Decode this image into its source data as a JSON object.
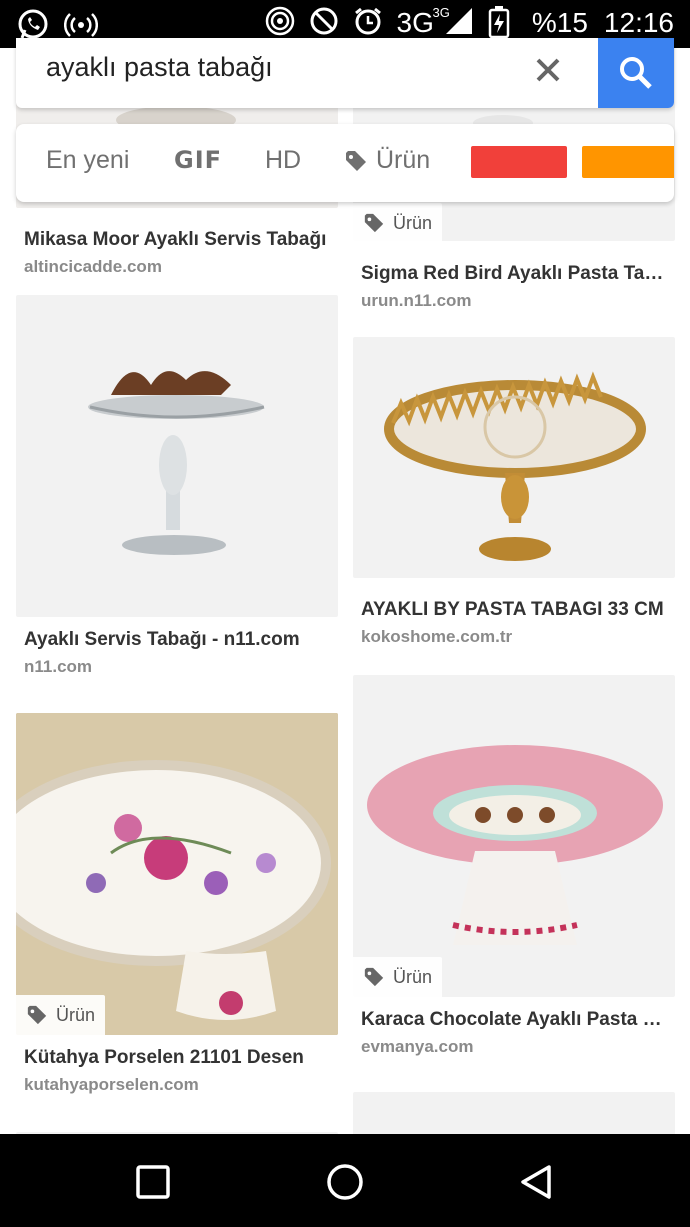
{
  "status_bar": {
    "icons": [
      "whatsapp-icon",
      "broadcast-icon",
      "hotspot-icon",
      "do-not-disturb-icon",
      "alarm-icon",
      "signal-icon",
      "battery-icon"
    ],
    "network": "3G",
    "network_sup": "3G",
    "battery": "%15",
    "time": "12:16"
  },
  "search": {
    "query": "ayaklı pasta tabağı",
    "clear_icon": "close-icon",
    "search_icon": "search-icon"
  },
  "filters": {
    "chips": [
      "En yeni",
      "GIF",
      "HD",
      "Ürün"
    ],
    "color_swatches": [
      "#f1403a",
      "#ff9500"
    ]
  },
  "results": [
    {
      "title": "Mikasa Moor Ayaklı Servis Tabağı",
      "domain": "altincicadde.com",
      "badge": ""
    },
    {
      "title": "Sigma Red Bird Ayaklı Pasta Tabağı",
      "domain": "urun.n11.com",
      "badge": "Ürün"
    },
    {
      "title": "Ayaklı Servis Tabağı - n11.com",
      "domain": "n11.com",
      "badge": ""
    },
    {
      "title": "AYAKLI BY PASTA TABAGI 33 CM",
      "domain": "kokoshome.com.tr",
      "badge": ""
    },
    {
      "title": "Kütahya Porselen 21101 Desen",
      "domain": "kutahyaporselen.com",
      "badge": "Ürün"
    },
    {
      "title": "Karaca Chocolate Ayaklı Pasta Tabağı",
      "domain": "evmanya.com",
      "badge": "Ürün"
    }
  ],
  "nav": {
    "buttons": [
      "recents-button",
      "home-button",
      "back-button"
    ]
  }
}
